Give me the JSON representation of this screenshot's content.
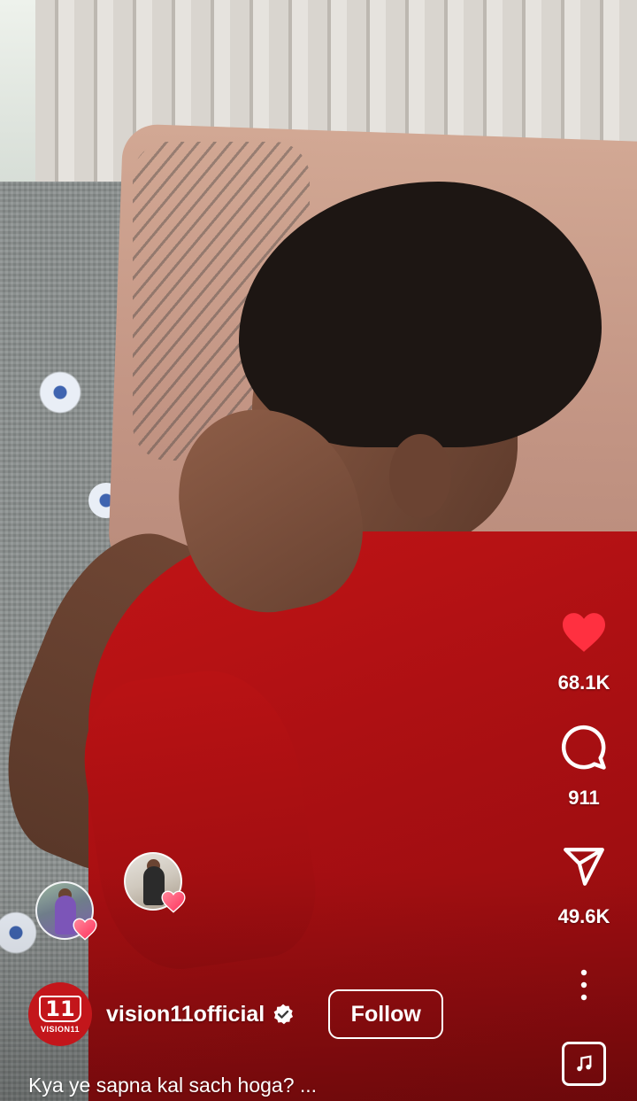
{
  "reel": {
    "username": "vision11official",
    "verified": true,
    "follow_label": "Follow",
    "caption": "Kya ye sapna kal sach hoga? ...",
    "avatar": {
      "mark": "11",
      "text": "VISION11",
      "color": "#c3161b"
    }
  },
  "actions": {
    "like_count": "68.1K",
    "comment_count": "911",
    "share_count": "49.6K",
    "liked": true,
    "like_color": "#ff3040"
  },
  "icons": {
    "like": "heart-filled-icon",
    "comment": "speech-bubble-icon",
    "share": "paper-plane-icon",
    "more": "more-vertical-icon",
    "audio": "music-note-icon",
    "verified": "verified-badge-icon"
  }
}
